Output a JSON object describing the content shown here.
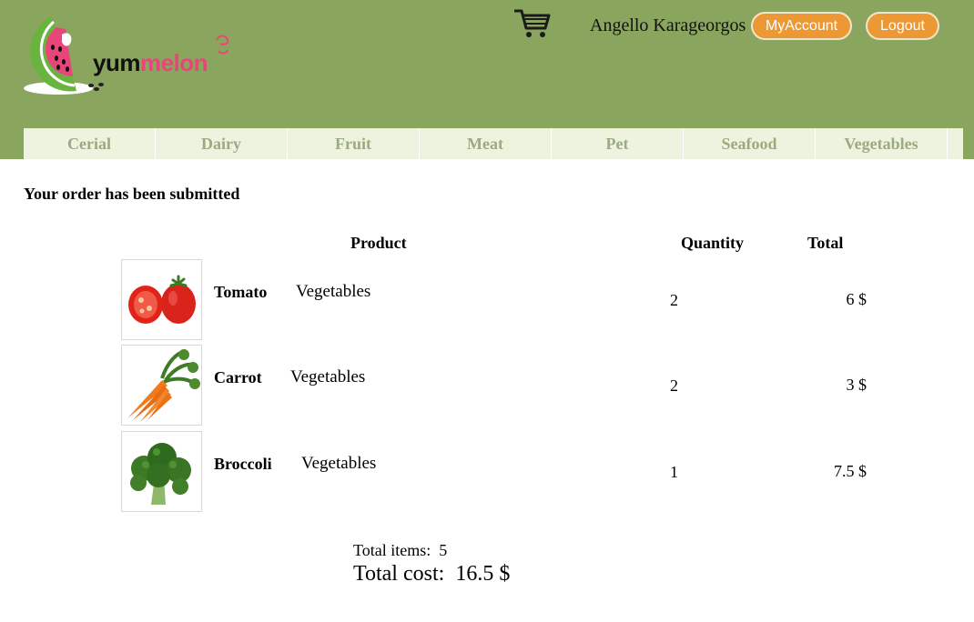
{
  "brand": {
    "part1": "yum",
    "part2": "melon"
  },
  "header": {
    "user_name": "Angello Karageorgos",
    "account_label": "MyAccount",
    "logout_label": "Logout",
    "cart_icon": "shopping-cart-icon"
  },
  "nav": [
    "Cerial",
    "Dairy",
    "Fruit",
    "Meat",
    "Pet",
    "Seafood",
    "Vegetables"
  ],
  "order": {
    "message": "Your order has been submitted",
    "columns": {
      "product": "Product",
      "quantity": "Quantity",
      "total": "Total"
    },
    "items": [
      {
        "name": "Tomato",
        "category": "Vegetables",
        "quantity": "2",
        "total": "6 $",
        "image": "tomato-image"
      },
      {
        "name": "Carrot",
        "category": "Vegetables",
        "quantity": "2",
        "total": "3 $",
        "image": "carrot-image"
      },
      {
        "name": "Broccoli",
        "category": "Vegetables",
        "quantity": "1",
        "total": "7.5 $",
        "image": "broccoli-image"
      }
    ],
    "summary": {
      "items_label": "Total items:",
      "items_value": "5",
      "cost_label": "Total cost:",
      "cost_value": "16.5 $"
    }
  },
  "colors": {
    "header_bg": "#8aa65e",
    "nav_bg": "#eef3e0",
    "nav_text": "#9aab80",
    "button_bg": "#ec9834",
    "logo_pink": "#e8457a"
  }
}
